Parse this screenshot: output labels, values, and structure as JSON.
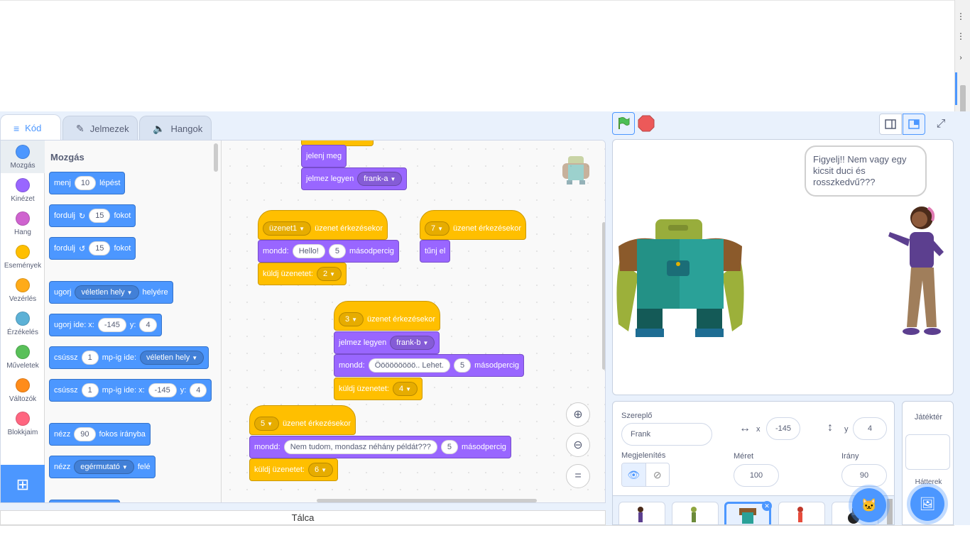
{
  "tabs": {
    "code": "Kód",
    "costumes": "Jelmezek",
    "sounds": "Hangok"
  },
  "categories": [
    "Mozgás",
    "Kinézet",
    "Hang",
    "Események",
    "Vezérlés",
    "Érzékelés",
    "Műveletek",
    "Változók",
    "Blokkjaim"
  ],
  "category_colors": [
    "#4c97ff",
    "#9966ff",
    "#cf63cf",
    "#ffbf00",
    "#ffab19",
    "#5cb1d6",
    "#59c059",
    "#ff8c1a",
    "#ff6680"
  ],
  "palette": {
    "title": "Mozgás",
    "b1": {
      "a": "menj",
      "v": "10",
      "b": "lépést"
    },
    "b2": {
      "a": "fordulj",
      "v": "15",
      "b": "fokot"
    },
    "b3": {
      "a": "fordulj",
      "v": "15",
      "b": "fokot"
    },
    "b4": {
      "a": "ugorj",
      "dd": "véletlen hely",
      "b": "helyére"
    },
    "b5": {
      "a": "ugorj ide: x:",
      "x": "-145",
      "b": "y:",
      "y": "4"
    },
    "b6": {
      "a": "csússz",
      "v": "1",
      "b": "mp-ig ide:",
      "dd": "véletlen hely"
    },
    "b7": {
      "a": "csússz",
      "v": "1",
      "b": "mp-ig ide: x:",
      "x": "-145",
      "c": "y:",
      "y": "4"
    },
    "b8": {
      "a": "nézz",
      "v": "90",
      "b": "fokos irányba"
    },
    "b9": {
      "a": "nézz",
      "dd": "egérmutató",
      "b": "felé"
    }
  },
  "script": {
    "s1": {
      "show": "jelenj meg",
      "costume_label": "jelmez legyen",
      "costume": "frank-a"
    },
    "s2": {
      "msg": "üzenet1",
      "hat": "üzenet érkezésekor",
      "say": "mondd:",
      "text": "Hello!",
      "secs": "5",
      "unit": "másodpercig",
      "send": "küldj üzenetet:",
      "send_val": "2"
    },
    "s3": {
      "msg": "7",
      "hat": "üzenet érkezésekor",
      "hide": "tűnj el"
    },
    "s4": {
      "msg": "3",
      "hat": "üzenet érkezésekor",
      "costume_label": "jelmez legyen",
      "costume": "frank-b",
      "say": "mondd:",
      "text": "Ööööööööö.. Lehet.",
      "secs": "5",
      "unit": "másodpercig",
      "send": "küldj üzenetet:",
      "send_val": "4"
    },
    "s5": {
      "msg": "5",
      "hat": "üzenet érkezésekor",
      "say": "mondd:",
      "text": "Nem tudom, mondasz néhány példát???",
      "secs": "5",
      "unit": "másodpercig",
      "send": "küldj üzenetet:",
      "send_val": "6"
    }
  },
  "tray": "Tálca",
  "stage": {
    "bubble": "Figyelj!! Nem vagy egy kicsit duci és rosszkedvű???"
  },
  "sprite_info": {
    "sprite_label": "Szereplő",
    "sprite_name": "Frank",
    "x_label": "x",
    "x": "-145",
    "y_label": "y",
    "y": "4",
    "show_label": "Megjelenítés",
    "size_label": "Méret",
    "size": "100",
    "dir_label": "Irány",
    "dir": "90"
  },
  "stage_pane": {
    "title": "Játéktér",
    "backdrops": "Hátterek"
  }
}
